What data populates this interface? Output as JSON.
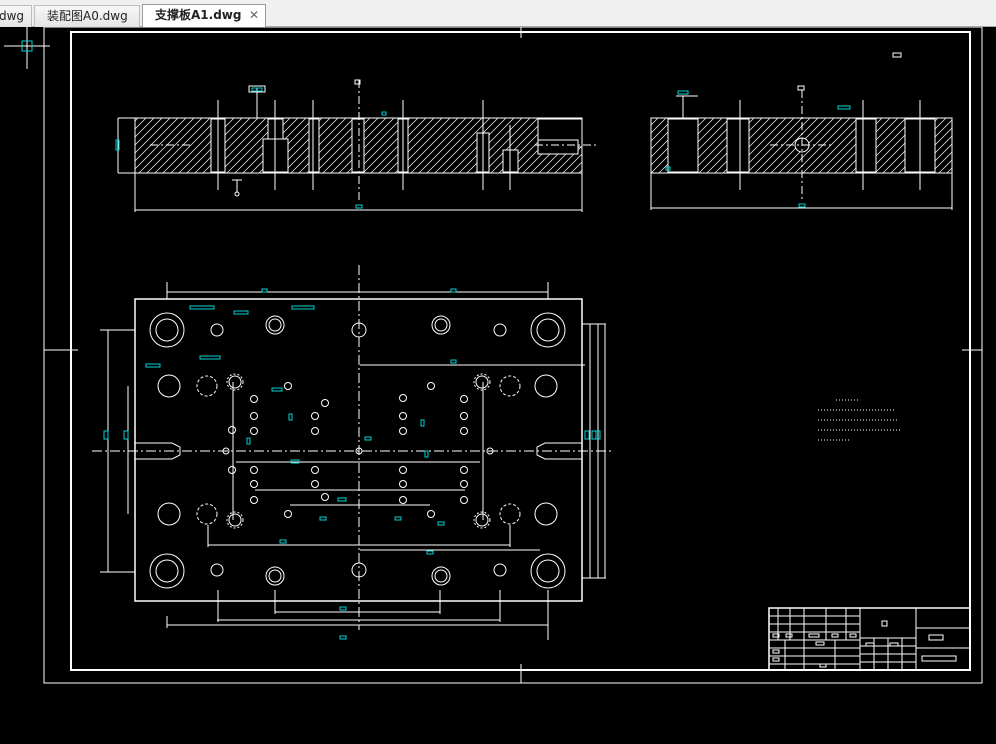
{
  "tabs": [
    {
      "label": "dwg",
      "active": false
    },
    {
      "label": "装配图A0.dwg",
      "active": false
    },
    {
      "label": "支撑板A1.dwg",
      "active": true,
      "close": "✕"
    }
  ],
  "colors": {
    "background": "#000000",
    "lines": "#ffffff",
    "dimensions": "#00d5d5",
    "tab_bar": "#f0f0f0"
  },
  "drawing": {
    "views": [
      "front-section-view",
      "side-section-view",
      "top-plan-view"
    ],
    "notes": "technical-requirements-block",
    "title_block": "title-block"
  }
}
